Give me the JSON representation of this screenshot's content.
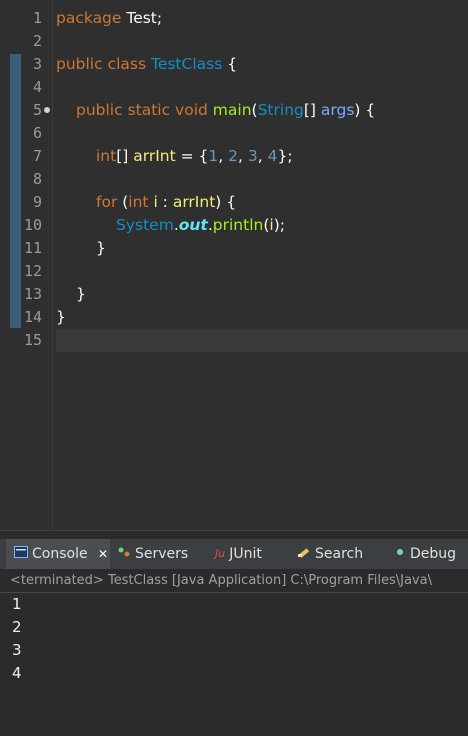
{
  "editor": {
    "line_numbers": [
      "1",
      "2",
      "3",
      "4",
      "5",
      "6",
      "7",
      "8",
      "9",
      "10",
      "11",
      "12",
      "13",
      "14",
      "15"
    ],
    "code": {
      "l1_kw": "package",
      "l1_rest": " Test;",
      "l3_kw": "public class",
      "l3_cls": "TestClass",
      "l3_rest": " {",
      "l5_kw": "public static void",
      "l5_m": "main",
      "l5_p1": "(",
      "l5_cls": "String",
      "l5_p2": "[] ",
      "l5_par": "args",
      "l5_p3": ") {",
      "l7_kw": "int",
      "l7_p1": "[] ",
      "l7_loc": "arrInt",
      "l7_p2": " = {",
      "l7_n1": "1",
      "l7_c1": ", ",
      "l7_n2": "2",
      "l7_c2": ", ",
      "l7_n3": "3",
      "l7_c3": ", ",
      "l7_n4": "4",
      "l7_p3": "};",
      "l9_kw": "for",
      "l9_p1": " (",
      "l9_kw2": "int",
      "l9_loc": " i",
      "l9_p2": " : ",
      "l9_loc2": "arrInt",
      "l9_p3": ") {",
      "l10_cls": "System",
      "l10_dot": ".",
      "l10_fld": "out",
      "l10_dot2": ".",
      "l10_m": "println",
      "l10_p1": "(",
      "l10_loc": "i",
      "l10_p2": ");",
      "l11": "}",
      "l13": "}",
      "l14": "}"
    }
  },
  "panel": {
    "tabs": [
      {
        "label": "Console",
        "icon": "console-icon",
        "close": "✕"
      },
      {
        "label": "Servers",
        "icon": "servers-icon"
      },
      {
        "label": "JUnit",
        "icon": "junit-icon"
      },
      {
        "label": "Search",
        "icon": "search-icon"
      },
      {
        "label": "Debug",
        "icon": "debug-icon"
      }
    ],
    "status": "<terminated> TestClass [Java Application] C:\\Program Files\\Java\\",
    "output": [
      "1",
      "2",
      "3",
      "4"
    ]
  }
}
